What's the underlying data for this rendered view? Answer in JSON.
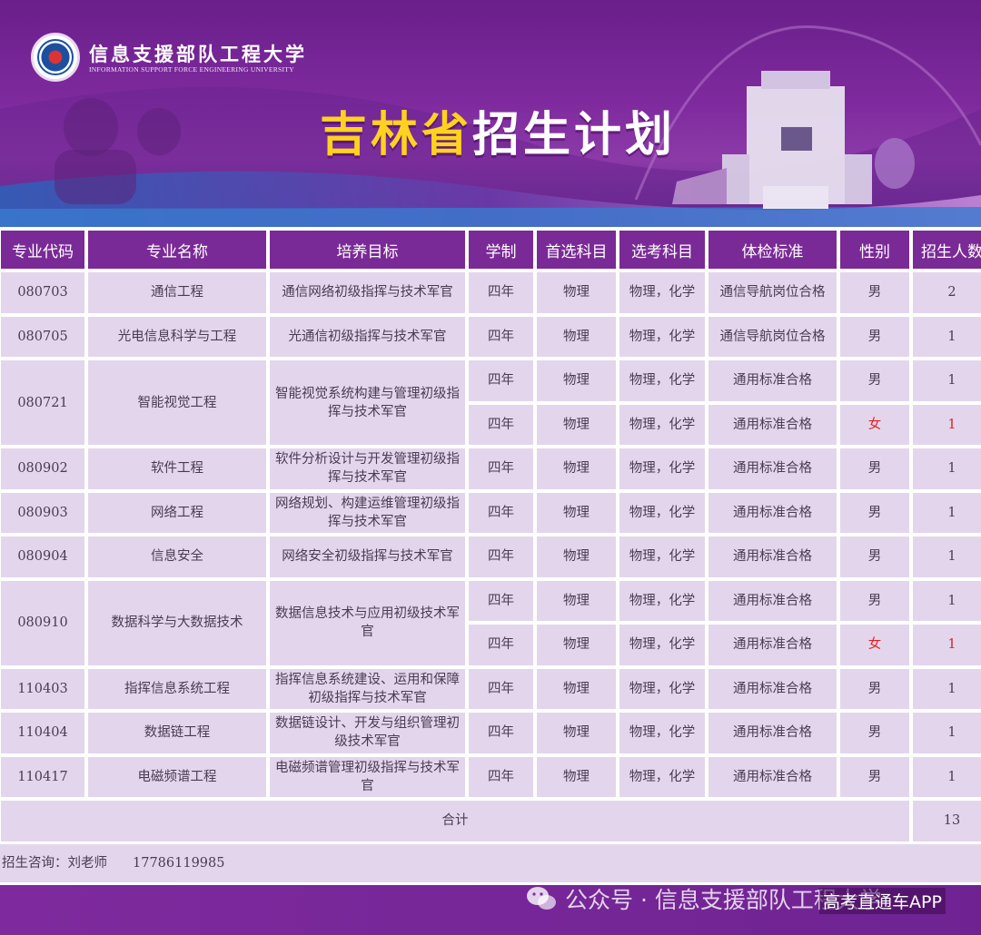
{
  "header": {
    "university_name": "信息支援部队工程大学",
    "university_name_en": "INFORMATION SUPPORT FORCE ENGINEERING UNIVERSITY",
    "title_province": "吉林省",
    "title_rest": "招生计划",
    "colors": {
      "title_province": "#ffd21f",
      "title_rest": "#ffffff",
      "banner": "#7e2a9e"
    }
  },
  "table": {
    "columns": [
      "专业代码",
      "专业名称",
      "培养目标",
      "学制",
      "首选科目",
      "选考科目",
      "体检标准",
      "性别",
      "招生人数"
    ],
    "rows": [
      {
        "code": "080703",
        "name": "通信工程",
        "goal": "通信网络初级指挥与技术军官",
        "years": "四年",
        "first": "物理",
        "elective": "物理，化学",
        "exam": "通信导航岗位合格",
        "gender": "男",
        "count": "2"
      },
      {
        "code": "080705",
        "name": "光电信息科学与工程",
        "goal": "光通信初级指挥与技术军官",
        "years": "四年",
        "first": "物理",
        "elective": "物理，化学",
        "exam": "通信导航岗位合格",
        "gender": "男",
        "count": "1"
      },
      {
        "code": "080721",
        "name": "智能视觉工程",
        "goal": "智能视觉系统构建与管理初级指挥与技术军官",
        "subrows": [
          {
            "years": "四年",
            "first": "物理",
            "elective": "物理，化学",
            "exam": "通用标准合格",
            "gender": "男",
            "count": "1"
          },
          {
            "years": "四年",
            "first": "物理",
            "elective": "物理，化学",
            "exam": "通用标准合格",
            "gender": "女",
            "count": "1"
          }
        ]
      },
      {
        "code": "080902",
        "name": "软件工程",
        "goal": "软件分析设计与开发管理初级指挥与技术军官",
        "years": "四年",
        "first": "物理",
        "elective": "物理，化学",
        "exam": "通用标准合格",
        "gender": "男",
        "count": "1"
      },
      {
        "code": "080903",
        "name": "网络工程",
        "goal": "网络规划、构建运维管理初级指挥与技术军官",
        "years": "四年",
        "first": "物理",
        "elective": "物理，化学",
        "exam": "通用标准合格",
        "gender": "男",
        "count": "1"
      },
      {
        "code": "080904",
        "name": "信息安全",
        "goal": "网络安全初级指挥与技术军官",
        "years": "四年",
        "first": "物理",
        "elective": "物理，化学",
        "exam": "通用标准合格",
        "gender": "男",
        "count": "1"
      },
      {
        "code": "080910",
        "name": "数据科学与大数据技术",
        "goal": "数据信息技术与应用初级技术军官",
        "subrows": [
          {
            "years": "四年",
            "first": "物理",
            "elective": "物理，化学",
            "exam": "通用标准合格",
            "gender": "男",
            "count": "1"
          },
          {
            "years": "四年",
            "first": "物理",
            "elective": "物理，化学",
            "exam": "通用标准合格",
            "gender": "女",
            "count": "1"
          }
        ]
      },
      {
        "code": "110403",
        "name": "指挥信息系统工程",
        "goal": "指挥信息系统建设、运用和保障初级指挥与技术军官",
        "years": "四年",
        "first": "物理",
        "elective": "物理，化学",
        "exam": "通用标准合格",
        "gender": "男",
        "count": "1"
      },
      {
        "code": "110404",
        "name": "数据链工程",
        "goal": "数据链设计、开发与组织管理初级技术军官",
        "years": "四年",
        "first": "物理",
        "elective": "物理，化学",
        "exam": "通用标准合格",
        "gender": "男",
        "count": "1"
      },
      {
        "code": "110417",
        "name": "电磁频谱工程",
        "goal": "电磁频谱管理初级指挥与技术军官",
        "years": "四年",
        "first": "物理",
        "elective": "物理，化学",
        "exam": "通用标准合格",
        "gender": "男",
        "count": "1"
      }
    ],
    "total_label": "合计",
    "total_value": "13",
    "female_color": "#e02020"
  },
  "consult": {
    "label": "招生咨询：刘老师",
    "phone": "17786119985"
  },
  "footer": {
    "watermark_text": "公众号 · 信息支援部队工程大学",
    "app_tag": "高考直通车APP",
    "watermark_icon": "wechat-icon"
  }
}
